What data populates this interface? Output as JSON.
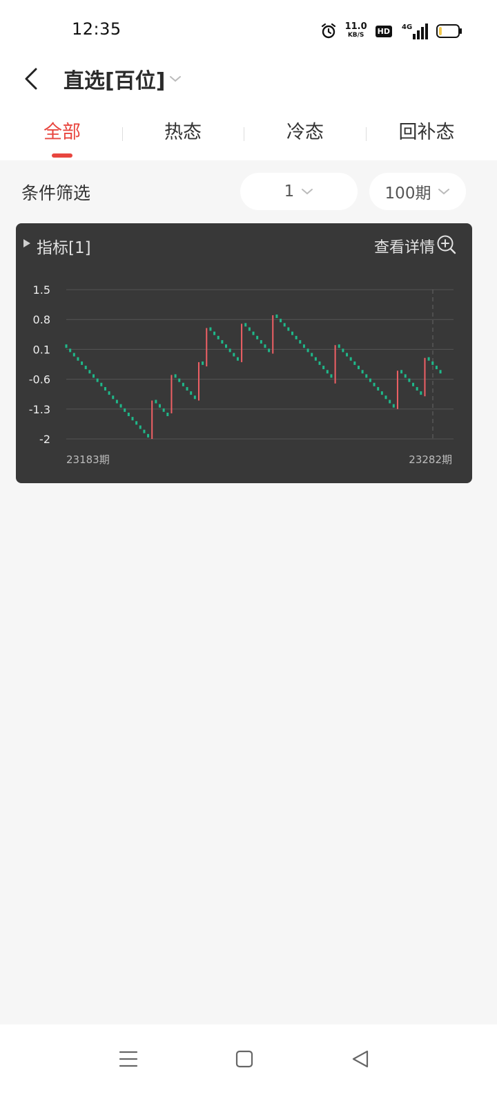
{
  "status_bar": {
    "time": "12:35",
    "net_speed_value": "11.0",
    "net_speed_unit": "KB/S",
    "hd_label": "HD",
    "signal_label": "4G",
    "battery_level": 0.15
  },
  "header": {
    "title": "直选[百位]",
    "tabs": [
      {
        "label": "全部",
        "active": true
      },
      {
        "label": "热态",
        "active": false
      },
      {
        "label": "冷态",
        "active": false
      },
      {
        "label": "回补态",
        "active": false
      }
    ]
  },
  "filter": {
    "label": "条件筛选",
    "option_value": "1",
    "period_value": "100期"
  },
  "card": {
    "title": "指标[1]",
    "detail_label": "查看详情"
  },
  "chart_data": {
    "type": "line",
    "y_ticks": [
      "1.5",
      "0.8",
      "0.1",
      "-0.6",
      "-1.3",
      "-2"
    ],
    "ylim": [
      -2,
      1.5
    ],
    "x_start_label": "23183期",
    "x_end_label": "23282期",
    "x_range": [
      23183,
      23282
    ],
    "step_down": 0.1,
    "rise_color": "#f06065",
    "fall_color": "#1fb88a",
    "rises": [
      {
        "period": 23205,
        "from": -2.0,
        "to": -1.1
      },
      {
        "period": 23210,
        "from": -1.4,
        "to": -0.5
      },
      {
        "period": 23217,
        "from": -1.1,
        "to": -0.2
      },
      {
        "period": 23219,
        "from": -0.3,
        "to": 0.6
      },
      {
        "period": 23228,
        "from": -0.2,
        "to": 0.7
      },
      {
        "period": 23236,
        "from": 0.0,
        "to": 0.9
      },
      {
        "period": 23252,
        "from": -0.7,
        "to": 0.2
      },
      {
        "period": 23268,
        "from": -1.3,
        "to": -0.4
      },
      {
        "period": 23275,
        "from": -1.0,
        "to": -0.1
      }
    ],
    "series_end": -0.9
  }
}
